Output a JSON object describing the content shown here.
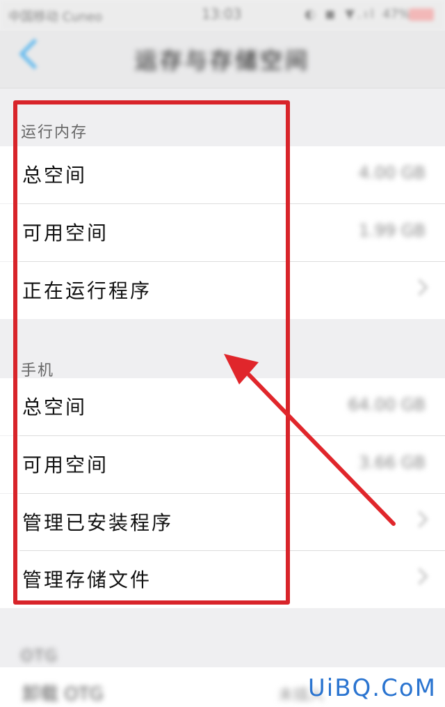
{
  "status_bar": {
    "carrier": "中国移动 Cuneo",
    "time": "13:03",
    "signal": "◐ ◼ ▼.ıl",
    "battery": "47%"
  },
  "nav": {
    "title": "运存与存储空间",
    "back_icon": "chevron-left-icon",
    "accent_color": "#59b6ee"
  },
  "sections": {
    "ram": {
      "header": "运行内存",
      "rows": [
        {
          "label": "总空间",
          "value": "4.00 GB"
        },
        {
          "label": "可用空间",
          "value": "1.99 GB"
        },
        {
          "label": "正在运行程序",
          "value": ""
        }
      ]
    },
    "phone": {
      "header": "手机",
      "rows": [
        {
          "label": "总空间",
          "value": "64.00 GB"
        },
        {
          "label": "可用空间",
          "value": "3.66 GB"
        },
        {
          "label": "管理已安装程序",
          "value": ""
        },
        {
          "label": "管理存储文件",
          "value": ""
        }
      ]
    },
    "otg": {
      "header": "OTG",
      "rows": [
        {
          "label": "卸载 OTG",
          "value": "未插入"
        }
      ]
    }
  },
  "annotation": {
    "highlight_color": "#d8242a",
    "arrow_color": "#e0262b"
  },
  "watermark": "UiBQ.CoM"
}
